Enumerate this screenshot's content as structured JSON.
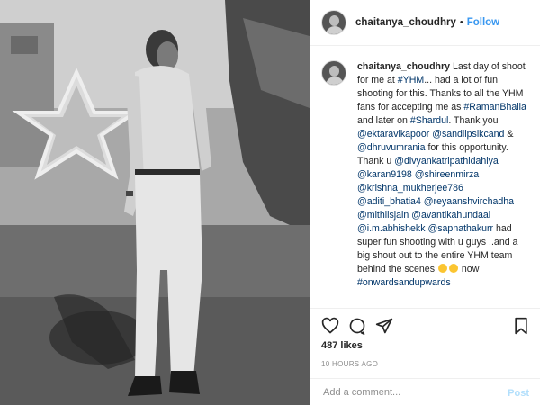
{
  "post": {
    "username": "chaitanya_choudhry",
    "separator": "•",
    "follow_label": "Follow"
  },
  "caption": {
    "username": "chaitanya_choudhry",
    "lines": [
      " Last day of shoot",
      "for me at ",
      "#YHM",
      "... had a lot of fun",
      "shooting for this. Thanks to all the YHM",
      "fans for accepting me as ",
      "#RamanBhalla",
      "and later on ",
      "#Shardul",
      ". Thank you",
      "@ektaravikapoor",
      "@sandiipsikcand",
      " &",
      "@dhruvumrania",
      " for this opportunity.",
      "Thank u ",
      "@divyankatripathidahiya",
      "@karan9198",
      "@shireenmirza",
      "@krishna_mukherjee786",
      "@aditi_bhatia4",
      "@reyaanshvirchadha",
      "@mithilsjain",
      "@avantikahundaal",
      "@i.m.abhishekk",
      "@sapnathakurr",
      " had",
      "super fun shooting with u guys ..and a",
      "big shout out to the entire YHM team",
      "behind the scenes",
      "now",
      "#onwardsandupwards"
    ],
    "time_ago": "10h"
  },
  "actions": {
    "icons": [
      "heart-icon",
      "comment-icon",
      "share-icon",
      "bookmark-icon"
    ]
  },
  "likes": "487 likes",
  "timestamp": "10 HOURS AGO",
  "comment": {
    "placeholder": "Add a comment...",
    "post_label": "Post"
  },
  "colors": {
    "link": "#003569",
    "follow": "#3897f0",
    "post_disabled": "#b2dffc",
    "muted": "#8e8e8e"
  }
}
